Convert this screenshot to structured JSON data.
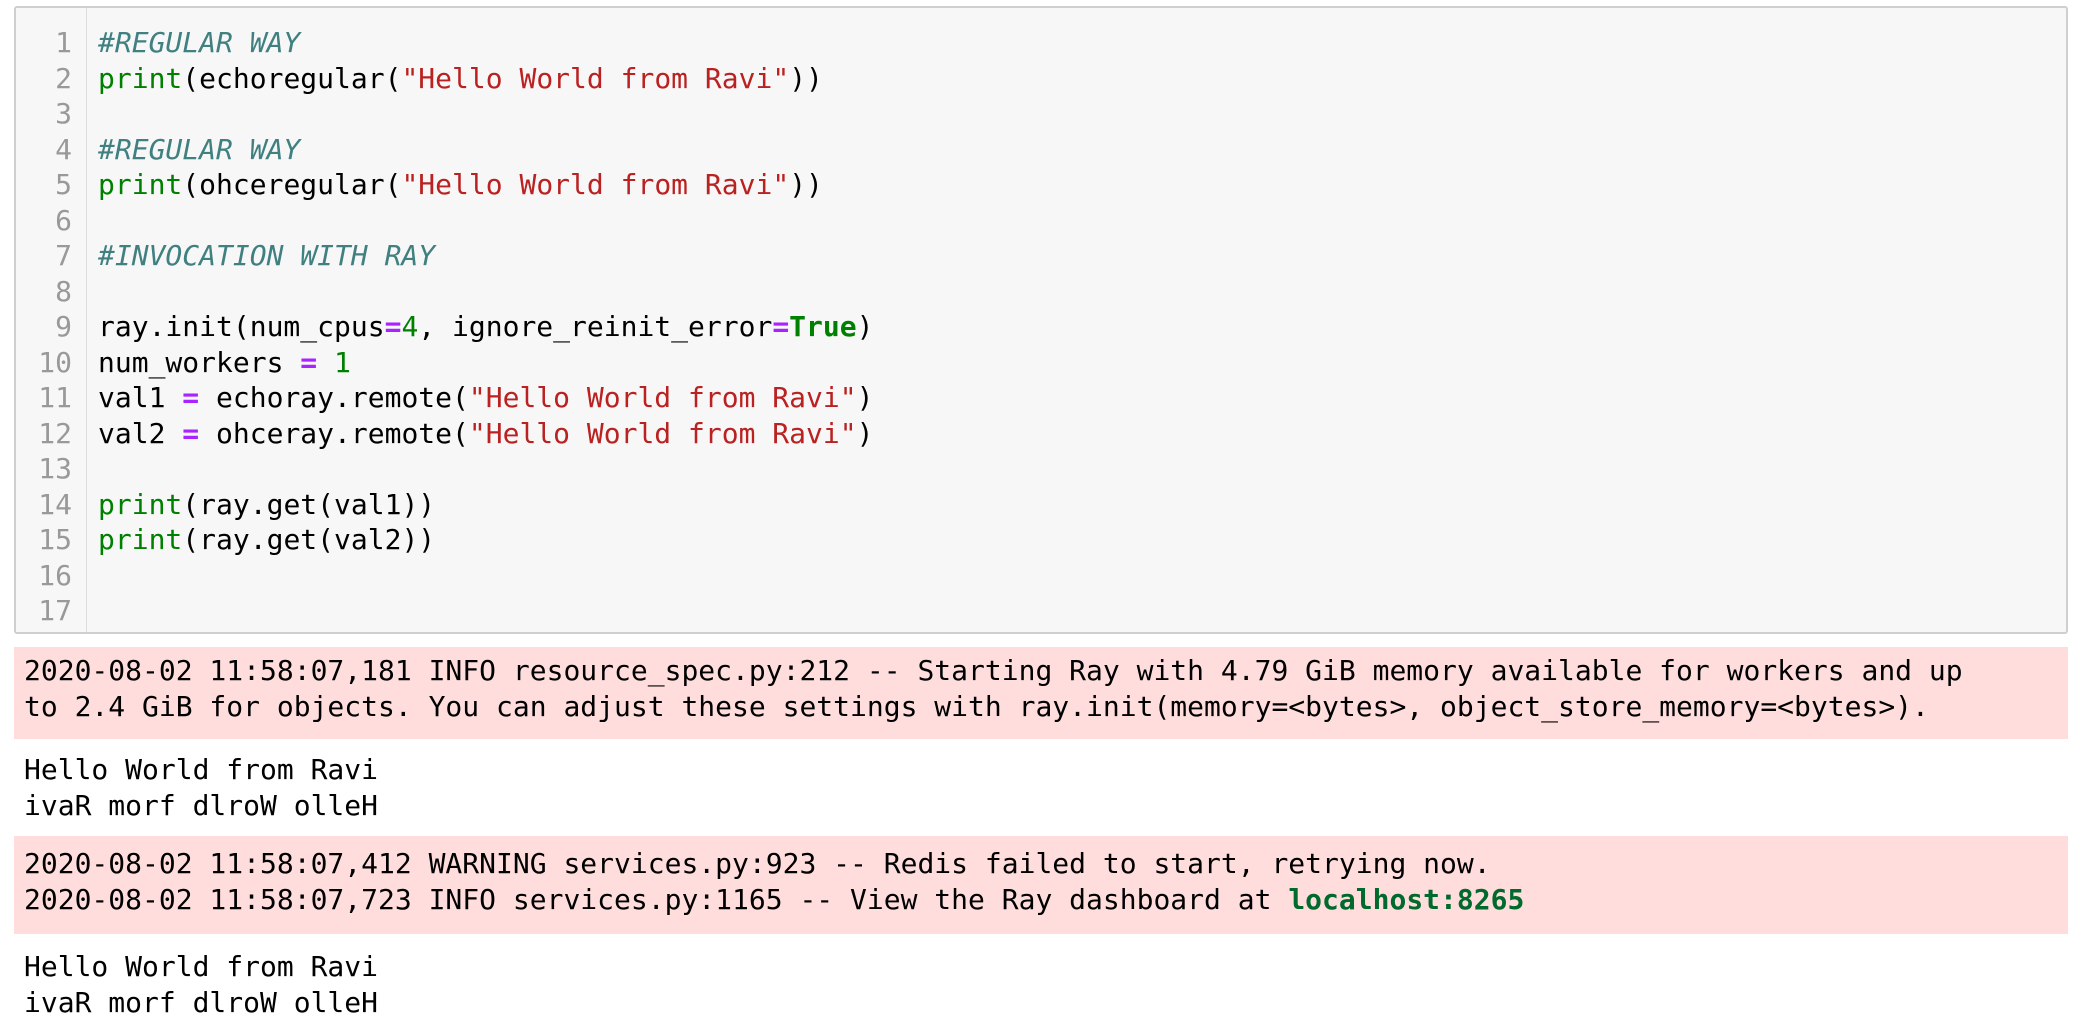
{
  "code_cell": {
    "line_numbers": [
      "1",
      "2",
      "3",
      "4",
      "5",
      "6",
      "7",
      "8",
      "9",
      "10",
      "11",
      "12",
      "13",
      "14",
      "15",
      "16",
      "17"
    ],
    "lines": [
      {
        "tokens": [
          {
            "t": "cm",
            "v": "#REGULAR WAY"
          }
        ]
      },
      {
        "tokens": [
          {
            "t": "bi",
            "v": "print"
          },
          {
            "t": "tx",
            "v": "(echoregular("
          },
          {
            "t": "st",
            "v": "\"Hello World from Ravi\""
          },
          {
            "t": "tx",
            "v": "))"
          }
        ]
      },
      {
        "tokens": []
      },
      {
        "tokens": [
          {
            "t": "cm",
            "v": "#REGULAR WAY"
          }
        ]
      },
      {
        "tokens": [
          {
            "t": "bi",
            "v": "print"
          },
          {
            "t": "tx",
            "v": "(ohceregular("
          },
          {
            "t": "st",
            "v": "\"Hello World from Ravi\""
          },
          {
            "t": "tx",
            "v": "))"
          }
        ]
      },
      {
        "tokens": []
      },
      {
        "tokens": [
          {
            "t": "cm",
            "v": "#INVOCATION WITH RAY"
          }
        ]
      },
      {
        "tokens": []
      },
      {
        "tokens": [
          {
            "t": "tx",
            "v": "ray.init(num_cpus"
          },
          {
            "t": "op",
            "v": "="
          },
          {
            "t": "nu",
            "v": "4"
          },
          {
            "t": "tx",
            "v": ", ignore_reinit_error"
          },
          {
            "t": "op",
            "v": "="
          },
          {
            "t": "kw",
            "v": "True"
          },
          {
            "t": "tx",
            "v": ")"
          }
        ]
      },
      {
        "tokens": [
          {
            "t": "tx",
            "v": "num_workers "
          },
          {
            "t": "op",
            "v": "="
          },
          {
            "t": "tx",
            "v": " "
          },
          {
            "t": "nu",
            "v": "1"
          }
        ]
      },
      {
        "tokens": [
          {
            "t": "tx",
            "v": "val1 "
          },
          {
            "t": "op",
            "v": "="
          },
          {
            "t": "tx",
            "v": " echoray.remote("
          },
          {
            "t": "st",
            "v": "\"Hello World from Ravi\""
          },
          {
            "t": "tx",
            "v": ")"
          }
        ]
      },
      {
        "tokens": [
          {
            "t": "tx",
            "v": "val2 "
          },
          {
            "t": "op",
            "v": "="
          },
          {
            "t": "tx",
            "v": " ohceray.remote("
          },
          {
            "t": "st",
            "v": "\"Hello World from Ravi\""
          },
          {
            "t": "tx",
            "v": ")"
          }
        ]
      },
      {
        "tokens": []
      },
      {
        "tokens": [
          {
            "t": "bi",
            "v": "print"
          },
          {
            "t": "tx",
            "v": "(ray.get(val1))"
          }
        ]
      },
      {
        "tokens": [
          {
            "t": "bi",
            "v": "print"
          },
          {
            "t": "tx",
            "v": "(ray.get(val2))"
          }
        ]
      },
      {
        "tokens": []
      },
      {
        "tokens": []
      }
    ]
  },
  "output": {
    "stderr_1": {
      "line_1": "2020-08-02 11:58:07,181 INFO resource_spec.py:212 -- Starting Ray with 4.79 GiB memory available for workers and up",
      "line_2": "to 2.4 GiB for objects. You can adjust these settings with ray.init(memory=<bytes>, object_store_memory=<bytes>)."
    },
    "stdout_1": {
      "line_1": "Hello World from Ravi",
      "line_2": "ivaR morf dlroW olleH"
    },
    "stderr_2": {
      "line_1": "2020-08-02 11:58:07,412 WARNING services.py:923 -- Redis failed to start, retrying now.",
      "line_2_prefix": "2020-08-02 11:58:07,723 INFO services.py:1165 -- View the Ray dashboard at ",
      "line_2_link": "localhost:8265"
    },
    "stdout_2": {
      "line_1": "Hello World from Ravi",
      "line_2": "ivaR morf dlroW olleH"
    }
  },
  "colors": {
    "stderr_background": "#ffdddd",
    "code_background": "#f7f7f7",
    "comment": "#408080",
    "builtin": "#008000",
    "string": "#ba2121",
    "operator": "#aa22ff",
    "link": "#00692c"
  }
}
